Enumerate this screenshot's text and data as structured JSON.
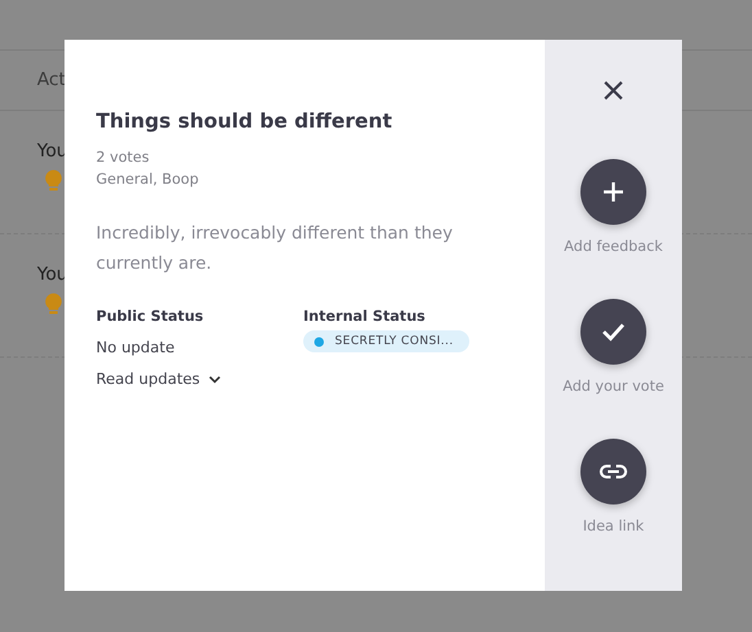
{
  "background": {
    "header": "Act",
    "rows": [
      {
        "text": "You"
      },
      {
        "text": "You"
      }
    ]
  },
  "modal": {
    "title": "Things should be different",
    "votes": "2 votes",
    "categories": "General, Boop",
    "description": "Incredibly, irrevocably different than they currently are.",
    "public_status": {
      "label": "Public Status",
      "value": "No update",
      "link": "Read updates"
    },
    "internal_status": {
      "label": "Internal Status",
      "value": "SECRETLY CONSI...",
      "color": "#1ea7e4"
    },
    "actions": [
      {
        "kind": "plus",
        "label": "Add feedback"
      },
      {
        "kind": "check",
        "label": "Add your vote"
      },
      {
        "kind": "link",
        "label": "Idea link"
      }
    ]
  }
}
